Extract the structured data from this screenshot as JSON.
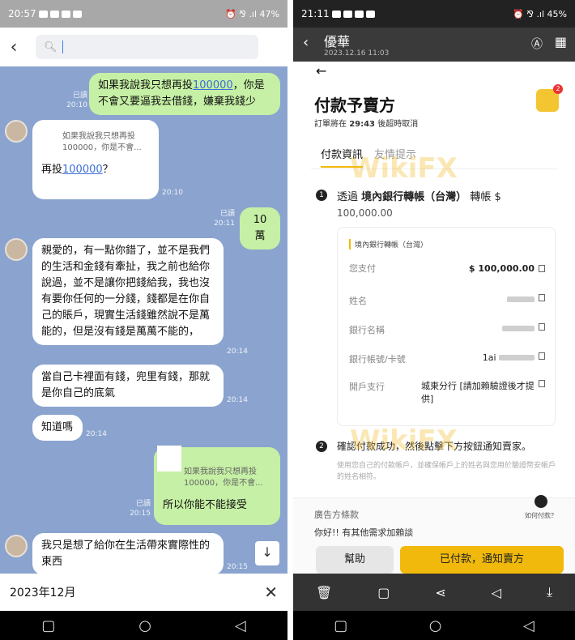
{
  "left_phone": {
    "status": {
      "time": "20:57",
      "right": "⏰ ⅋ .ıl 47%"
    },
    "chat": [
      {
        "sender": "me",
        "text_pre": "如果我說我只想再投",
        "link": "100000",
        "text_post": "，你是不會又要逼我去借錢，嫌棄我錢少",
        "read": "已讀",
        "time": "20:10"
      },
      {
        "sender": "them",
        "quote": "如果我說我只想再投100000，你是不會...",
        "text_pre": "再投",
        "link": "100000",
        "text_post": "？",
        "time": "20:10"
      },
      {
        "sender": "me",
        "text": "10萬",
        "read": "已讀",
        "time": "20:11"
      },
      {
        "sender": "them",
        "text": "親愛的，有一點你錯了，並不是我們的生活和金錢有牽扯，我之前也給你說過，並不是讓你把錢給我，我也沒有要你任何的一分錢，錢都是在你自己的賬戶，現實生活錢雖然說不是萬能的，但是沒有錢是萬萬不能的，",
        "time": "20:14"
      },
      {
        "sender": "them",
        "text": "當自己卡裡面有錢，兜里有錢，那就是你自己的底氣",
        "time": "20:14"
      },
      {
        "sender": "them",
        "text": "知道嗎",
        "time": "20:14"
      },
      {
        "sender": "me",
        "quote": "如果我說我只想再投100000，你是不會...",
        "text": "所以你能不能接受",
        "read": "已讀",
        "time": "20:15"
      },
      {
        "sender": "them",
        "text": "我只是想了給你在生活帶來實際性的東西",
        "time": "20:15"
      }
    ],
    "date_label": "2023年12月"
  },
  "right_phone": {
    "status": {
      "time": "21:11",
      "right": "⏰ ⅋ .ıl 45%"
    },
    "seller": "優華",
    "seller_date": "2023.12.16 11:03",
    "title": "付款予賣方",
    "countdown": {
      "prefix": "訂單將在",
      "value": "29:43",
      "suffix": "後超時取消"
    },
    "badge": "2",
    "tabs": [
      "付款資訊",
      "友情提示"
    ],
    "step1": {
      "num": "1",
      "pre": "透過",
      "method": "境內銀行轉帳（台灣）",
      "post": "轉帳 $",
      "amount": "100,000.00"
    },
    "card": {
      "chip": "境內銀行轉帳（台灣）",
      "rows": [
        {
          "label": "您支付",
          "value": "$ 100,000.00"
        },
        {
          "label": "姓名",
          "value": ""
        },
        {
          "label": "銀行名稱",
          "value": ""
        },
        {
          "label": "銀行帳號/卡號",
          "value": "1ai"
        },
        {
          "label": "開戶支行",
          "value": "城東分行 [請加賴驗證後才提供]"
        }
      ]
    },
    "step2": {
      "num": "2",
      "text": "確認付款成功，然後點擊下方按鈕通知賣家。"
    },
    "hint": "使用您自己的付款帳戶，並確保帳戶上的姓名與您用於驗證幣安帳戶的姓名相符。",
    "how_pay": "如何付款？",
    "ad_title": "廣告方條款",
    "ad_text": "你好!! 有其他需求加賴談",
    "help_btn": "幫助",
    "paid_btn": "已付款，通知賣方",
    "watermark": "WikiFX"
  }
}
